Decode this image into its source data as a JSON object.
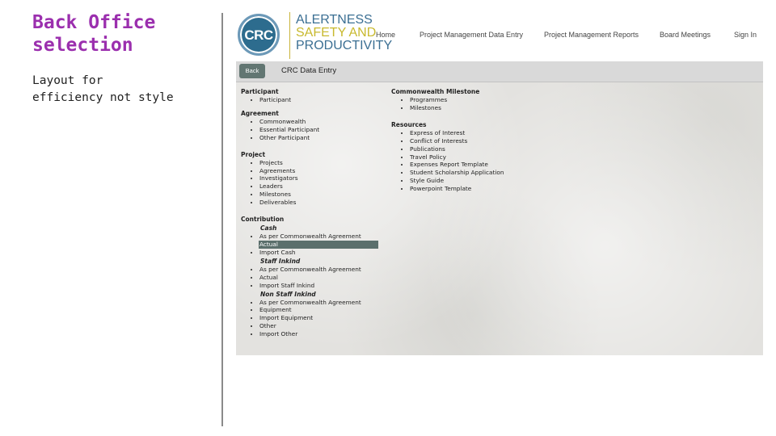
{
  "slide": {
    "title": "Back Office selection",
    "subtitle": "Layout for\nefficiency not style"
  },
  "logo": {
    "abbr": "CRC",
    "line1": "ALERTNESS",
    "line2": "SAFETY AND",
    "line3": "PRODUCTIVITY"
  },
  "nav": [
    "Home",
    "Project Management Data Entry",
    "Project Management Reports",
    "Board Meetings",
    "Sign In"
  ],
  "toolbar": {
    "back_label": "Back",
    "title": "CRC Data Entry"
  },
  "colors": {
    "title": "#9b2fae",
    "back_button": "#627672",
    "selected_row": "#5b6f6c",
    "logo_blue": "#3b6f93",
    "logo_gold": "#c8b92e"
  },
  "icons": [
    "crc-logo-icon"
  ],
  "left_column": {
    "participant": {
      "heading": "Participant",
      "items": [
        "Participant"
      ]
    },
    "agreement": {
      "heading": "Agreement",
      "items": [
        "Commonwealth",
        "Essential Participant",
        "Other Participant"
      ]
    },
    "project": {
      "heading": "Project",
      "items": [
        "Projects",
        "Agreements",
        "Investigators",
        "Leaders",
        "Milestones",
        "Deliverables"
      ]
    },
    "contribution": {
      "heading": "Contribution",
      "cash": {
        "label": "Cash",
        "items": [
          "As per Commonwealth Agreement",
          "Actual",
          "Import Cash"
        ]
      },
      "staff": {
        "label": "Staff Inkind",
        "items": [
          "As per Commonwealth Agreement",
          "Actual",
          "Import Staff Inkind"
        ]
      },
      "nonstaff": {
        "label": "Non Staff Inkind",
        "items": [
          "As per Commonwealth Agreement",
          "Equipment",
          "Import Equipment",
          "Other",
          "Import Other"
        ]
      }
    }
  },
  "right_column": {
    "milestone": {
      "heading": "Commonwealth Milestone",
      "items": [
        "Programmes",
        "Milestones"
      ]
    },
    "resources": {
      "heading": "Resources",
      "items": [
        "Express of Interest",
        "Conflict of Interests",
        "Publications",
        "Travel Policy",
        "Expenses Report Template",
        "Student Scholarship Application",
        "Style Guide",
        "Powerpoint Template"
      ]
    }
  }
}
